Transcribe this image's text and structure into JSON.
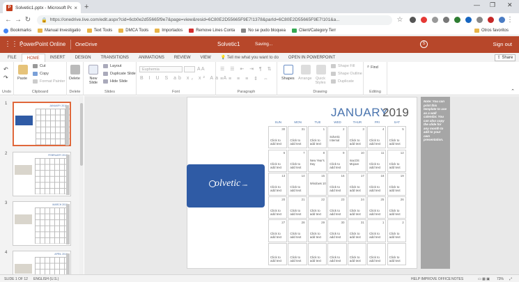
{
  "browser": {
    "tab_title": "Solvetic1.pptx - Microsoft Powe…",
    "url": "https://onedrive.live.com/edit.aspx?cid=6cb0e2d55665f9e7&page=view&resid=6C80E2D55665F9E7!1378&parId=6C80E2D55665F9E7!101&a...",
    "bookmarks": [
      {
        "label": "Bookmarks",
        "icon": "star-icon"
      },
      {
        "label": "Manual Investigatio",
        "icon": "folder-icon"
      },
      {
        "label": "Text Tools",
        "icon": "folder-icon"
      },
      {
        "label": "DMCA Tools",
        "icon": "folder-icon"
      },
      {
        "label": "Importados",
        "icon": "folder-icon"
      },
      {
        "label": "Remove Lines Conta",
        "icon": "page-icon"
      },
      {
        "label": "No se pudo bloquea",
        "icon": "page-icon"
      },
      {
        "label": "Client/Category Terr",
        "icon": "page-icon"
      }
    ],
    "other_favorites": "Otros favoritos"
  },
  "app": {
    "name": "PowerPoint Online",
    "service": "OneDrive",
    "file_name": "Solvetic1",
    "status": "Saving...",
    "sign_out": "Sign out"
  },
  "ribbon_tabs": [
    "FILE",
    "HOME",
    "INSERT",
    "DESIGN",
    "TRANSITIONS",
    "ANIMATIONS",
    "REVIEW",
    "VIEW"
  ],
  "tell_me": "Tell me what you want to do",
  "open_in": "OPEN IN POWERPOINT",
  "share": "Share",
  "ribbon": {
    "undo_label": "Undo",
    "paste": "Paste",
    "cut": "Cut",
    "copy": "Copy",
    "format_painter": "Format Painter",
    "clipboard": "Clipboard",
    "delete": "Delete",
    "delete_group": "Delete",
    "new_slide": "New Slide",
    "layout": "Layout",
    "duplicate_slide": "Duplicate Slide",
    "hide_slide": "Hide Slide",
    "slides": "Slides",
    "font_name": "Euphemia",
    "font_group": "Font",
    "paragraph": "Paragraph",
    "shapes": "Shapes",
    "arrange": "Arrange",
    "quick_styles": "Quick Styles",
    "shape_fill": "Shape Fill",
    "shape_outline": "Shape Outline",
    "duplicate": "Duplicate",
    "drawing": "Drawing",
    "find": "Find",
    "editing": "Editing"
  },
  "thumbnails": [
    {
      "num": "1",
      "month": "JANUARY 2019",
      "selected": true
    },
    {
      "num": "2",
      "month": "FEBRUARY 2019",
      "selected": false
    },
    {
      "num": "3",
      "month": "MARCH 2019",
      "selected": false
    },
    {
      "num": "4",
      "month": "APRIL 2019",
      "selected": false
    }
  ],
  "slide": {
    "month": "JANUARY",
    "year": "2019",
    "logo": "olvetic",
    "logo_sub": ".com",
    "days": [
      "SUN",
      "MON",
      "TUE",
      "WED",
      "THUR",
      "FRI",
      "SAT"
    ],
    "cell_text": "Click to add text",
    "dates": [
      [
        "30",
        "31",
        "1",
        "2",
        "3",
        "4",
        "5"
      ],
      [
        "6",
        "7",
        "8",
        "9",
        "10",
        "11",
        "12"
      ],
      [
        "13",
        "14",
        "15",
        "16",
        "17",
        "18",
        "19"
      ],
      [
        "20",
        "21",
        "22",
        "23",
        "24",
        "25",
        "26"
      ],
      [
        "27",
        "28",
        "29",
        "30",
        "31",
        "1",
        "2"
      ],
      [
        "",
        "",
        "",
        "",
        "",
        "",
        ""
      ]
    ],
    "events": {
      "1-2": "New Year's Day",
      "0-3": "Solvetic Internal",
      "2-2": "Windows 10",
      "1-4": "macOS Mojave"
    },
    "note": "Note: You can print this template to use as a wall calendar. You can also copy the slide for any month to add to your own presentation."
  },
  "status": {
    "slide": "SLIDE 1 OF 12",
    "language": "ENGLISH (U.S.)",
    "help": "HELP IMPROVE OFFICE",
    "notes": "NOTES",
    "zoom": "73%"
  }
}
